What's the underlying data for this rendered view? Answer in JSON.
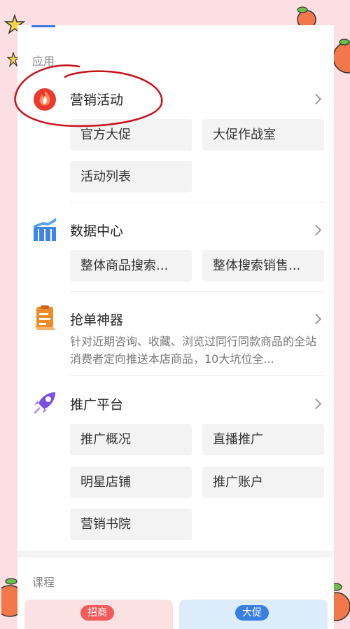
{
  "sections": {
    "apps": {
      "title": "应用"
    },
    "courses": {
      "title": "课程"
    }
  },
  "apps": [
    {
      "name": "营销活动",
      "icon": "fire-icon",
      "items": [
        "官方大促",
        "大促作战室",
        "活动列表"
      ]
    },
    {
      "name": "数据中心",
      "icon": "bar-chart-icon",
      "items": [
        "整体商品搜索...",
        "整体搜索销售..."
      ]
    },
    {
      "name": "抢单神器",
      "icon": "clipboard-icon",
      "description": "针对近期咨询、收藏、浏览过同行同款商品的全站消费者定向推送本店商品，10大坑位全..."
    },
    {
      "name": "推广平台",
      "icon": "rocket-icon",
      "items": [
        "推广概况",
        "直播推广",
        "明星店铺",
        "推广账户",
        "营销书院"
      ]
    }
  ],
  "courses": [
    {
      "tag": "招商",
      "color": "#f35a5a"
    },
    {
      "tag": "大促",
      "color": "#3a7fe0"
    }
  ],
  "colors": {
    "accent": "#3a78e5",
    "background": "#fbdfe3",
    "annotation": "#c8121c"
  }
}
